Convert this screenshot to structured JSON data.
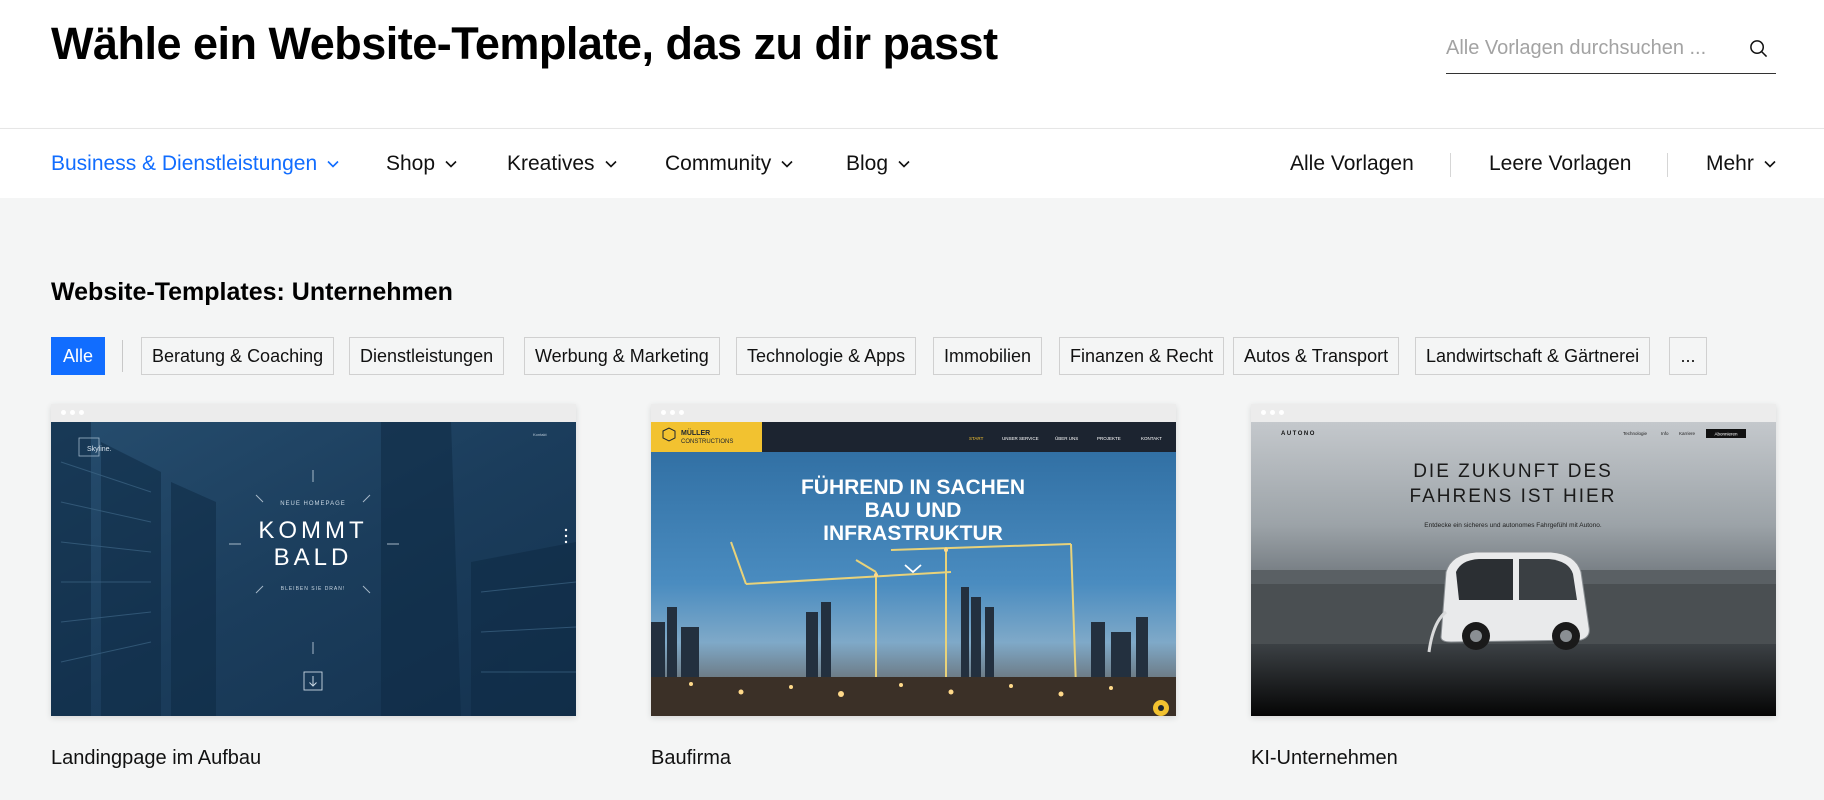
{
  "header": {
    "title": "Wähle ein Website-Template, das zu dir passt",
    "search_placeholder": "Alle Vorlagen durchsuchen ..."
  },
  "nav": {
    "categories": [
      {
        "label": "Business & Dienstleistungen",
        "active": true
      },
      {
        "label": "Shop"
      },
      {
        "label": "Kreatives"
      },
      {
        "label": "Community"
      },
      {
        "label": "Blog"
      }
    ],
    "links": [
      "Alle Vorlagen",
      "Leere Vorlagen"
    ],
    "more": "Mehr"
  },
  "section": {
    "title": "Website-Templates: Unternehmen"
  },
  "filters": [
    "Alle",
    "Beratung & Coaching",
    "Dienstleistungen",
    "Werbung & Marketing",
    "Technologie & Apps",
    "Immobilien",
    "Finanzen & Recht",
    "Autos & Transport",
    "Landwirtschaft & Gärtnerei",
    "..."
  ],
  "templates": [
    {
      "name": "Landingpage im Aufbau",
      "preview": {
        "logo": "Skyline.",
        "small_nav": "Kontakt",
        "kicker": "NEUE HOMEPAGE",
        "headline_1": "KOMMT",
        "headline_2": "BALD",
        "sub": "BLEIBEN SIE DRAN!"
      }
    },
    {
      "name": "Baufirma",
      "preview": {
        "logo_1": "MÜLLER",
        "logo_2": "CONSTRUCTIONS",
        "menu": [
          "START",
          "UNSER SERVICE",
          "ÜBER UNS",
          "PROJEKTE",
          "KONTAKT"
        ],
        "headline_1": "FÜHREND IN SACHEN",
        "headline_2": "BAU UND",
        "headline_3": "INFRASTRUKTUR"
      }
    },
    {
      "name": "KI-Unternehmen",
      "preview": {
        "logo": "AUTONO",
        "menu": [
          "Technologie",
          "Info",
          "Karriere"
        ],
        "button": "Abonnieren",
        "headline_1": "DIE ZUKUNFT DES",
        "headline_2": "FAHRENS IST HIER",
        "sub": "Entdecke ein sicheres und autonomes Fahrgefühl mit Autono."
      }
    }
  ],
  "colors": {
    "accent": "#116dff",
    "page_bg": "#f4f5f5",
    "builder_yellow": "#f2c230"
  }
}
